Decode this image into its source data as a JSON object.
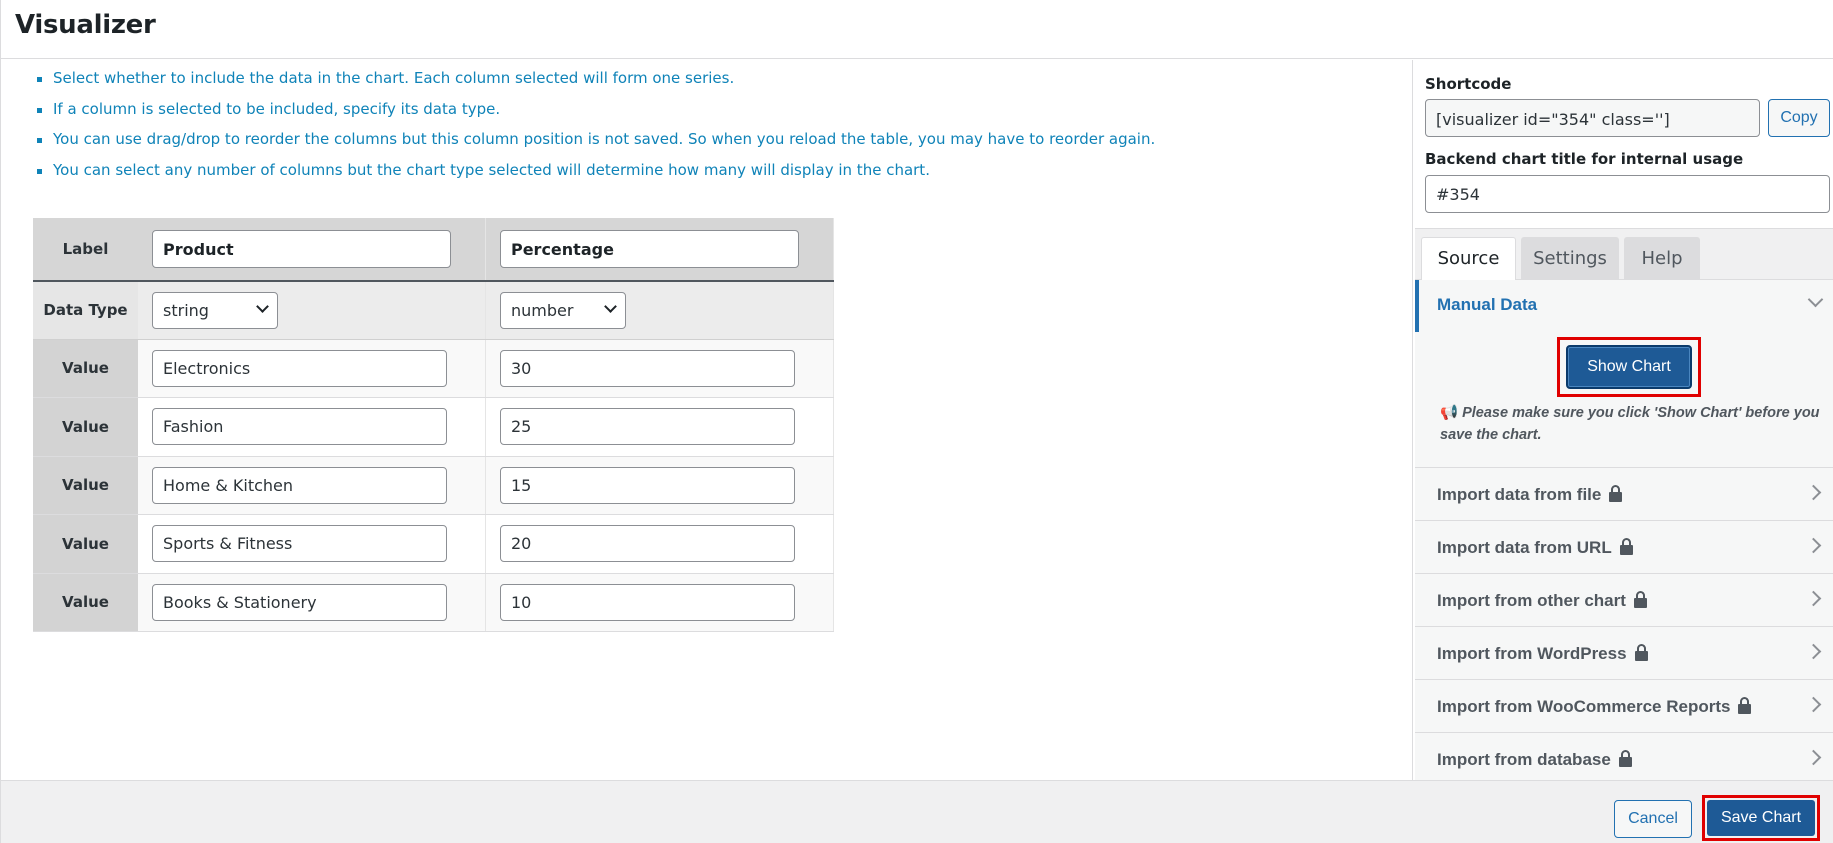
{
  "header": {
    "title": "Visualizer"
  },
  "instructions": [
    "Select whether to include the data in the chart. Each column selected will form one series.",
    "If a column is selected to be included, specify its data type.",
    "You can use drag/drop to reorder the columns but this column position is not saved. So when you reload the table, you may have to reorder again.",
    "You can select any number of columns but the chart type selected will determine how many will display in the chart."
  ],
  "table": {
    "label_header": "Label",
    "data_type_label": "Data Type",
    "value_label": "Value",
    "columns": [
      {
        "name": "Product",
        "type": "string"
      },
      {
        "name": "Percentage",
        "type": "number"
      }
    ],
    "rows": [
      [
        "Electronics",
        "30"
      ],
      [
        "Fashion",
        "25"
      ],
      [
        "Home & Kitchen",
        "15"
      ],
      [
        "Sports & Fitness",
        "20"
      ],
      [
        "Books & Stationery",
        "10"
      ]
    ]
  },
  "sidebar": {
    "shortcode_label": "Shortcode",
    "shortcode_value": "[visualizer id=\"354\" class='']",
    "copy_label": "Copy",
    "backend_title_label": "Backend chart title for internal usage",
    "backend_title_value": "#354",
    "tabs": [
      "Source",
      "Settings",
      "Help"
    ],
    "manual_data": {
      "title": "Manual Data",
      "show_chart_label": "Show Chart",
      "note": "Please make sure you click 'Show Chart' before you save the chart."
    },
    "import_items": [
      "Import data from file",
      "Import data from URL",
      "Import from other chart",
      "Import from WordPress",
      "Import from WooCommerce Reports",
      "Import from database"
    ]
  },
  "footer": {
    "cancel_label": "Cancel",
    "save_label": "Save Chart"
  },
  "colors": {
    "accent": "#2271b1",
    "primary_button": "#1e5a96",
    "highlight": "#e00000",
    "instruction_text": "#0f83b8"
  }
}
